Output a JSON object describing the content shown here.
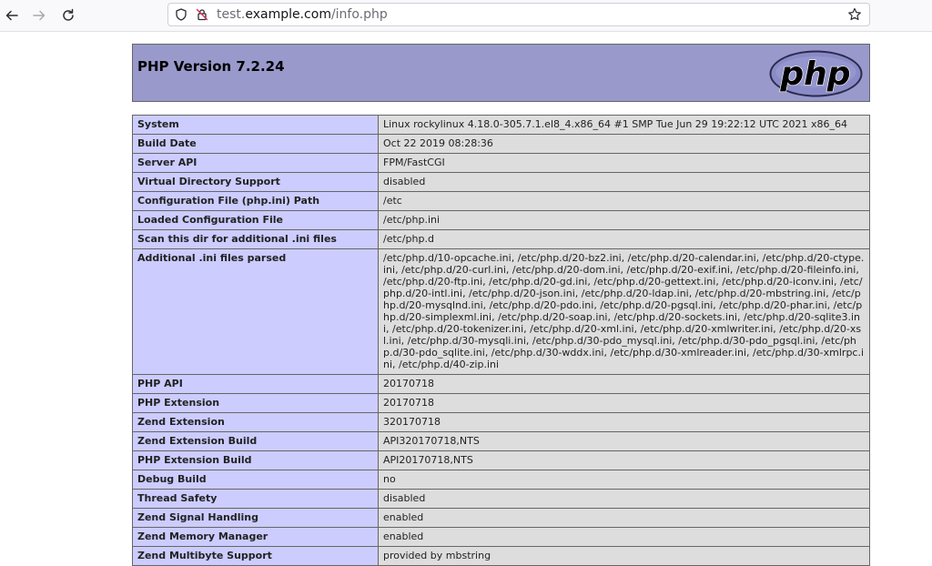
{
  "browser": {
    "url_prefix": "test.",
    "url_host": "example.com",
    "url_path": "/info.php"
  },
  "page": {
    "title": "PHP Version 7.2.24",
    "logo_text": "php"
  },
  "rows": [
    {
      "label": "System",
      "value": "Linux rockylinux 4.18.0-305.7.1.el8_4.x86_64 #1 SMP Tue Jun 29 19:22:12 UTC 2021 x86_64"
    },
    {
      "label": "Build Date",
      "value": "Oct 22 2019 08:28:36"
    },
    {
      "label": "Server API",
      "value": "FPM/FastCGI"
    },
    {
      "label": "Virtual Directory Support",
      "value": "disabled"
    },
    {
      "label": "Configuration File (php.ini) Path",
      "value": "/etc"
    },
    {
      "label": "Loaded Configuration File",
      "value": "/etc/php.ini"
    },
    {
      "label": "Scan this dir for additional .ini files",
      "value": "/etc/php.d"
    },
    {
      "label": "Additional .ini files parsed",
      "value": "/etc/php.d/10-opcache.ini, /etc/php.d/20-bz2.ini, /etc/php.d/20-calendar.ini, /etc/php.d/20-ctype.ini, /etc/php.d/20-curl.ini, /etc/php.d/20-dom.ini, /etc/php.d/20-exif.ini, /etc/php.d/20-fileinfo.ini, /etc/php.d/20-ftp.ini, /etc/php.d/20-gd.ini, /etc/php.d/20-gettext.ini, /etc/php.d/20-iconv.ini, /etc/php.d/20-intl.ini, /etc/php.d/20-json.ini, /etc/php.d/20-ldap.ini, /etc/php.d/20-mbstring.ini, /etc/php.d/20-mysqlnd.ini, /etc/php.d/20-pdo.ini, /etc/php.d/20-pgsql.ini, /etc/php.d/20-phar.ini, /etc/php.d/20-simplexml.ini, /etc/php.d/20-soap.ini, /etc/php.d/20-sockets.ini, /etc/php.d/20-sqlite3.ini, /etc/php.d/20-tokenizer.ini, /etc/php.d/20-xml.ini, /etc/php.d/20-xmlwriter.ini, /etc/php.d/20-xsl.ini, /etc/php.d/30-mysqli.ini, /etc/php.d/30-pdo_mysql.ini, /etc/php.d/30-pdo_pgsql.ini, /etc/php.d/30-pdo_sqlite.ini, /etc/php.d/30-wddx.ini, /etc/php.d/30-xmlreader.ini, /etc/php.d/30-xmlrpc.ini, /etc/php.d/40-zip.ini"
    },
    {
      "label": "PHP API",
      "value": "20170718"
    },
    {
      "label": "PHP Extension",
      "value": "20170718"
    },
    {
      "label": "Zend Extension",
      "value": "320170718"
    },
    {
      "label": "Zend Extension Build",
      "value": "API320170718,NTS"
    },
    {
      "label": "PHP Extension Build",
      "value": "API20170718,NTS"
    },
    {
      "label": "Debug Build",
      "value": "no"
    },
    {
      "label": "Thread Safety",
      "value": "disabled"
    },
    {
      "label": "Zend Signal Handling",
      "value": "enabled"
    },
    {
      "label": "Zend Memory Manager",
      "value": "enabled"
    },
    {
      "label": "Zend Multibyte Support",
      "value": "provided by mbstring"
    }
  ],
  "colors": {
    "header_bg": "#9999cc",
    "label_bg": "#ccccff",
    "value_bg": "#dddddd",
    "border": "#666666"
  }
}
